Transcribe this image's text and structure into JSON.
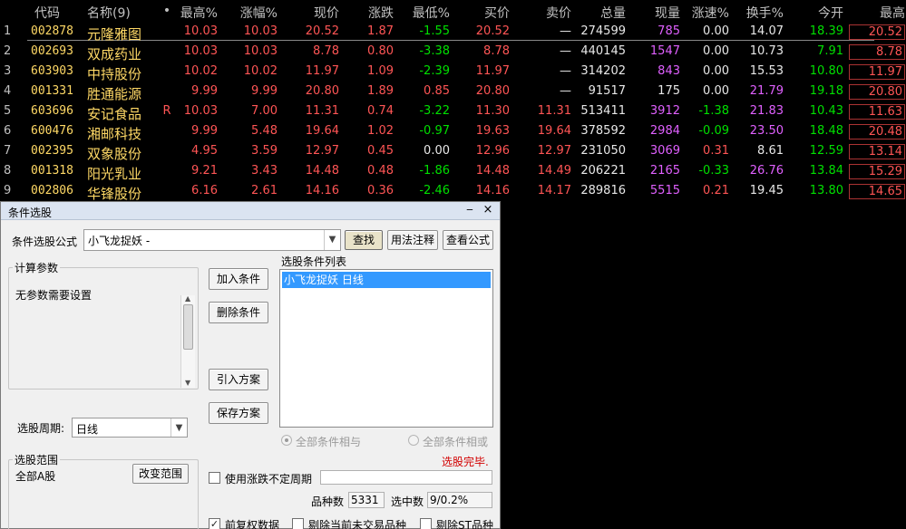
{
  "table": {
    "headers": {
      "code": "代码",
      "name": "名称(9)",
      "flag": "•",
      "high_pct": "最高%",
      "pct": "涨幅%",
      "price": "现价",
      "chg": "涨跌",
      "low_pct": "最低%",
      "bid": "买价",
      "ask": "卖价",
      "vol": "总量",
      "cur": "现量",
      "spd": "涨速%",
      "turn": "换手%",
      "open": "今开",
      "max": "最高"
    },
    "rows": [
      {
        "idx": "1",
        "code": "002878",
        "name": "元隆雅图",
        "flag": "",
        "high_pct": "10.03",
        "pct": "10.03",
        "price": "20.52",
        "chg": "1.87",
        "low_pct": "-1.55",
        "bid": "20.52",
        "ask": "—",
        "vol": "274599",
        "cur": "785",
        "spd": "0.00",
        "turn": "14.07",
        "open": "18.39",
        "max": "20.52"
      },
      {
        "idx": "2",
        "code": "002693",
        "name": "双成药业",
        "flag": "",
        "high_pct": "10.03",
        "pct": "10.03",
        "price": "8.78",
        "chg": "0.80",
        "low_pct": "-3.38",
        "bid": "8.78",
        "ask": "—",
        "vol": "440145",
        "cur": "1547",
        "spd": "0.00",
        "turn": "10.73",
        "open": "7.91",
        "max": "8.78"
      },
      {
        "idx": "3",
        "code": "603903",
        "name": "中持股份",
        "flag": "",
        "high_pct": "10.02",
        "pct": "10.02",
        "price": "11.97",
        "chg": "1.09",
        "low_pct": "-2.39",
        "bid": "11.97",
        "ask": "—",
        "vol": "314202",
        "cur": "843",
        "spd": "0.00",
        "turn": "15.53",
        "open": "10.80",
        "max": "11.97"
      },
      {
        "idx": "4",
        "code": "001331",
        "name": "胜通能源",
        "flag": "",
        "high_pct": "9.99",
        "pct": "9.99",
        "price": "20.80",
        "chg": "1.89",
        "low_pct": "0.85",
        "bid": "20.80",
        "ask": "—",
        "vol": "91517",
        "cur": "175",
        "spd": "0.00",
        "turn": "21.79",
        "open": "19.18",
        "max": "20.80"
      },
      {
        "idx": "5",
        "code": "603696",
        "name": "安记食品",
        "flag": "R",
        "high_pct": "10.03",
        "pct": "7.00",
        "price": "11.31",
        "chg": "0.74",
        "low_pct": "-3.22",
        "bid": "11.30",
        "ask": "11.31",
        "vol": "513411",
        "cur": "3912",
        "spd": "-1.38",
        "turn": "21.83",
        "open": "10.43",
        "max": "11.63"
      },
      {
        "idx": "6",
        "code": "600476",
        "name": "湘邮科技",
        "flag": "",
        "high_pct": "9.99",
        "pct": "5.48",
        "price": "19.64",
        "chg": "1.02",
        "low_pct": "-0.97",
        "bid": "19.63",
        "ask": "19.64",
        "vol": "378592",
        "cur": "2984",
        "spd": "-0.09",
        "turn": "23.50",
        "open": "18.48",
        "max": "20.48"
      },
      {
        "idx": "7",
        "code": "002395",
        "name": "双象股份",
        "flag": "",
        "high_pct": "4.95",
        "pct": "3.59",
        "price": "12.97",
        "chg": "0.45",
        "low_pct": "0.00",
        "bid": "12.96",
        "ask": "12.97",
        "vol": "231050",
        "cur": "3069",
        "spd": "0.31",
        "turn": "8.61",
        "open": "12.59",
        "max": "13.14"
      },
      {
        "idx": "8",
        "code": "001318",
        "name": "阳光乳业",
        "flag": "",
        "high_pct": "9.21",
        "pct": "3.43",
        "price": "14.48",
        "chg": "0.48",
        "low_pct": "-1.86",
        "bid": "14.48",
        "ask": "14.49",
        "vol": "206221",
        "cur": "2165",
        "spd": "-0.33",
        "turn": "26.76",
        "open": "13.84",
        "max": "15.29"
      },
      {
        "idx": "9",
        "code": "002806",
        "name": "华锋股份",
        "flag": "",
        "high_pct": "6.16",
        "pct": "2.61",
        "price": "14.16",
        "chg": "0.36",
        "low_pct": "-2.46",
        "bid": "14.16",
        "ask": "14.17",
        "vol": "289816",
        "cur": "5515",
        "spd": "0.21",
        "turn": "19.45",
        "open": "13.80",
        "max": "14.65"
      }
    ]
  },
  "dialog": {
    "title": "条件选股",
    "min": "‒",
    "close": "×",
    "formula_label": "条件选股公式",
    "formula_value": "小飞龙捉妖  -",
    "find_btn": "查找",
    "usage_btn": "用法注释",
    "view_btn": "查看公式",
    "params_legend": "计算参数",
    "params_text": "无参数需要设置",
    "add_btn": "加入条件",
    "delete_btn": "删除条件",
    "import_btn": "引入方案",
    "save_btn": "保存方案",
    "cond_list_label": "选股条件列表",
    "cond_items": [
      "小飞龙捉妖  日线"
    ],
    "period_label": "选股周期:",
    "period_value": "日线",
    "radio_and": "全部条件相与",
    "radio_or": "全部条件相或",
    "status": "选股完毕.",
    "range_legend": "选股范围",
    "range_value": "全部A股",
    "change_range_btn": "改变范围",
    "use_period_label": "使用涨跌不定周期",
    "count_label": "品种数",
    "count_value": "5331",
    "selected_label": "选中数",
    "selected_value": "9/0.2%",
    "adj_label": "前复权数据",
    "excl_suspend_label": "剔除当前未交易品种",
    "excl_st_label": "剔除ST品种"
  },
  "colors": {
    "up": "#ff5555",
    "down": "#00e000",
    "code": "#ffd966",
    "vol": "#e060ff"
  }
}
